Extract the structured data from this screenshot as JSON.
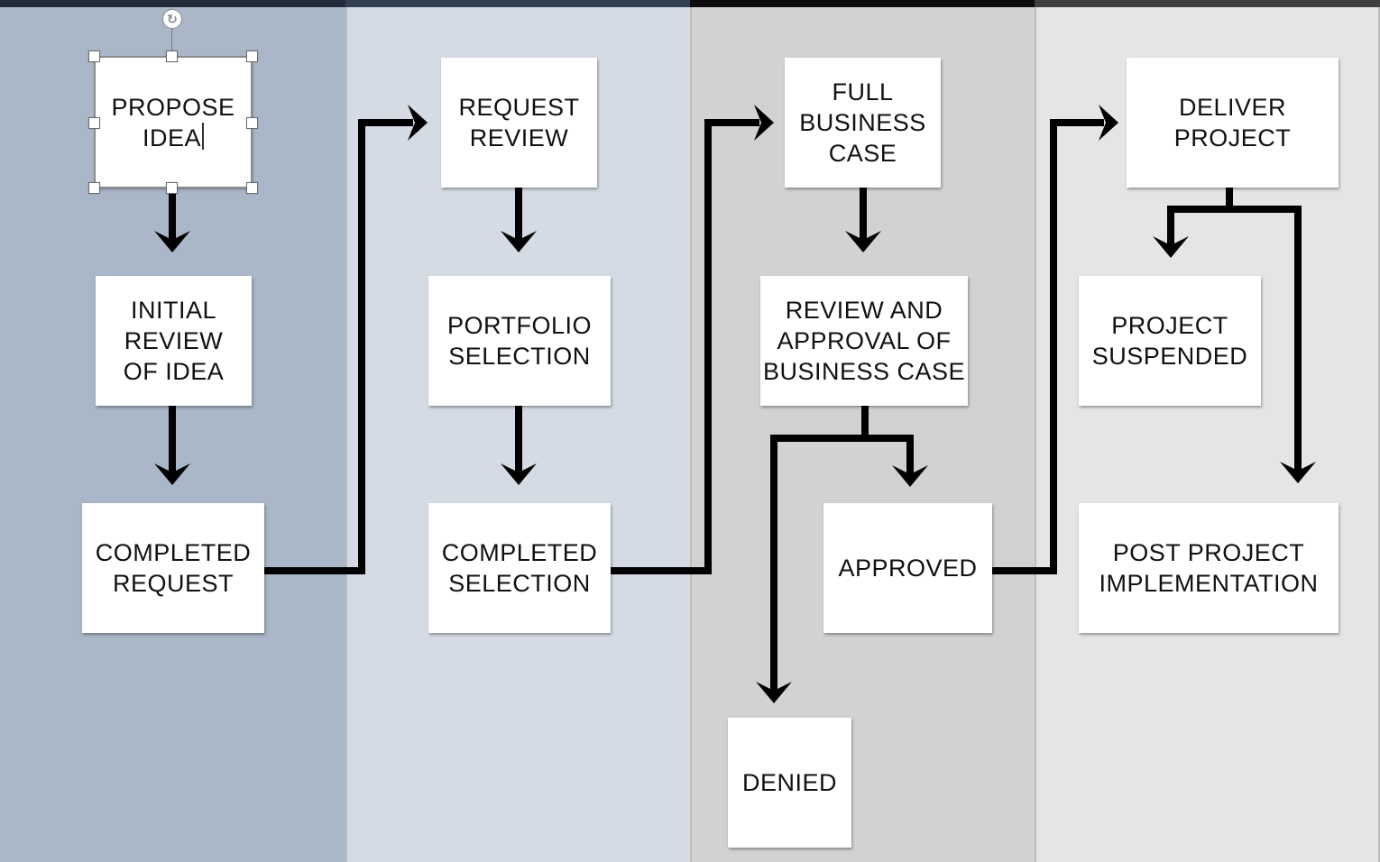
{
  "diagram": {
    "type": "swimlane-flowchart",
    "lanes": [
      {
        "id": "lane-0",
        "header_color": "#222b3a",
        "fill_color": "#aab7c9"
      },
      {
        "id": "lane-1",
        "header_color": "#333f52",
        "fill_color": "#d5dbe4"
      },
      {
        "id": "lane-2",
        "header_color": "#0c0c0c",
        "fill_color": "#d2d2d2"
      },
      {
        "id": "lane-3",
        "header_color": "#404040",
        "fill_color": "#e5e5e5"
      }
    ],
    "nodes": {
      "propose_idea": {
        "label": "PROPOSE\nIDEA",
        "lane": 0,
        "selected": true,
        "editing": true
      },
      "initial_review": {
        "label": "INITIAL\nREVIEW\nOF IDEA",
        "lane": 0
      },
      "completed_request": {
        "label": "COMPLETED\nREQUEST",
        "lane": 0
      },
      "request_review": {
        "label": "REQUEST\nREVIEW",
        "lane": 1
      },
      "portfolio_selection": {
        "label": "PORTFOLIO\nSELECTION",
        "lane": 1
      },
      "completed_selection": {
        "label": "COMPLETED\nSELECTION",
        "lane": 1
      },
      "full_business_case": {
        "label": "FULL\nBUSINESS\nCASE",
        "lane": 2
      },
      "review_approval": {
        "label": "REVIEW AND\nAPPROVAL OF\nBUSINESS CASE",
        "lane": 2
      },
      "approved": {
        "label": "APPROVED",
        "lane": 2
      },
      "denied": {
        "label": "DENIED",
        "lane": 2
      },
      "deliver_project": {
        "label": "DELIVER\nPROJECT",
        "lane": 3
      },
      "project_suspended": {
        "label": "PROJECT\nSUSPENDED",
        "lane": 3
      },
      "post_project": {
        "label": "POST PROJECT\nIMPLEMENTATION",
        "lane": 3
      }
    },
    "edges": [
      {
        "from": "propose_idea",
        "to": "initial_review"
      },
      {
        "from": "initial_review",
        "to": "completed_request"
      },
      {
        "from": "completed_request",
        "to": "request_review"
      },
      {
        "from": "request_review",
        "to": "portfolio_selection"
      },
      {
        "from": "portfolio_selection",
        "to": "completed_selection"
      },
      {
        "from": "completed_selection",
        "to": "full_business_case"
      },
      {
        "from": "full_business_case",
        "to": "review_approval"
      },
      {
        "from": "review_approval",
        "to": "approved"
      },
      {
        "from": "review_approval",
        "to": "denied"
      },
      {
        "from": "approved",
        "to": "deliver_project"
      },
      {
        "from": "deliver_project",
        "to": "project_suspended"
      },
      {
        "from": "deliver_project",
        "to": "post_project"
      }
    ],
    "connector_color": "#000000",
    "selection": {
      "rotate_icon": "rotate-icon",
      "rotate_glyph": "↻"
    }
  }
}
